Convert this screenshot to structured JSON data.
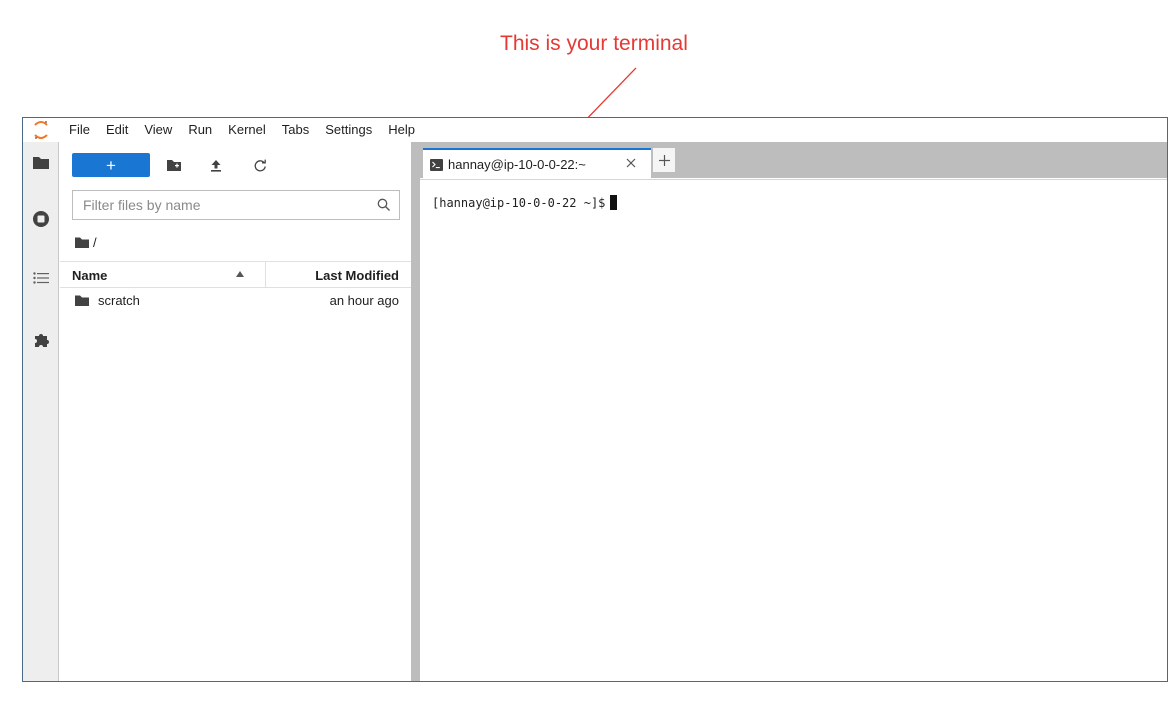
{
  "annotation": {
    "text": "This is your terminal",
    "color": "#e53935"
  },
  "menubar": {
    "items": [
      "File",
      "Edit",
      "View",
      "Run",
      "Kernel",
      "Tabs",
      "Settings",
      "Help"
    ]
  },
  "rail": {
    "icons": [
      "folder-icon",
      "running-sessions-icon",
      "table-of-contents-icon",
      "extensions-icon"
    ]
  },
  "filebrowser": {
    "new_button_label": "+",
    "search_placeholder": "Filter files by name",
    "breadcrumb": "/",
    "columns": {
      "name": "Name",
      "modified": "Last Modified"
    },
    "files": [
      {
        "name": "scratch",
        "type": "folder",
        "modified": "an hour ago"
      }
    ]
  },
  "tabs": {
    "active_tab_label": "hannay@ip-10-0-0-22:~"
  },
  "terminal": {
    "prompt": "[hannay@ip-10-0-0-22 ~]$"
  },
  "colors": {
    "accent": "#1976d2",
    "panel_gray": "#bdbdbd",
    "frame_border": "#4a6a8a"
  }
}
